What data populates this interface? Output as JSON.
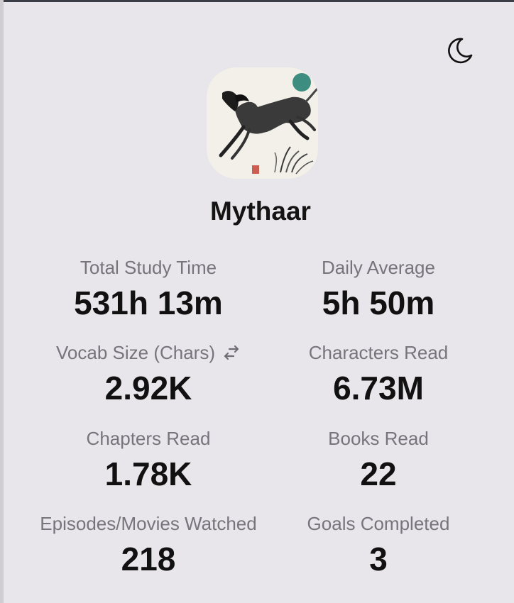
{
  "profile": {
    "username": "Mythaar",
    "status_color": "#3e8d81"
  },
  "theme_toggle": {
    "icon": "moon-icon"
  },
  "stats": {
    "total_study_time": {
      "label": "Total Study Time",
      "value": "531h 13m"
    },
    "daily_average": {
      "label": "Daily Average",
      "value": "5h 50m"
    },
    "vocab_size": {
      "label": "Vocab Size (Chars)",
      "value": "2.92K",
      "icon": "swap-arrows-icon"
    },
    "characters_read": {
      "label": "Characters Read",
      "value": "6.73M"
    },
    "chapters_read": {
      "label": "Chapters Read",
      "value": "1.78K"
    },
    "books_read": {
      "label": "Books Read",
      "value": "22"
    },
    "episodes_watched": {
      "label": "Episodes/Movies Watched",
      "value": "218"
    },
    "goals_completed": {
      "label": "Goals Completed",
      "value": "3"
    }
  },
  "colors": {
    "background": "#e8e6ea",
    "label": "#77757b",
    "value": "#111111",
    "accent": "#3e8d81"
  }
}
